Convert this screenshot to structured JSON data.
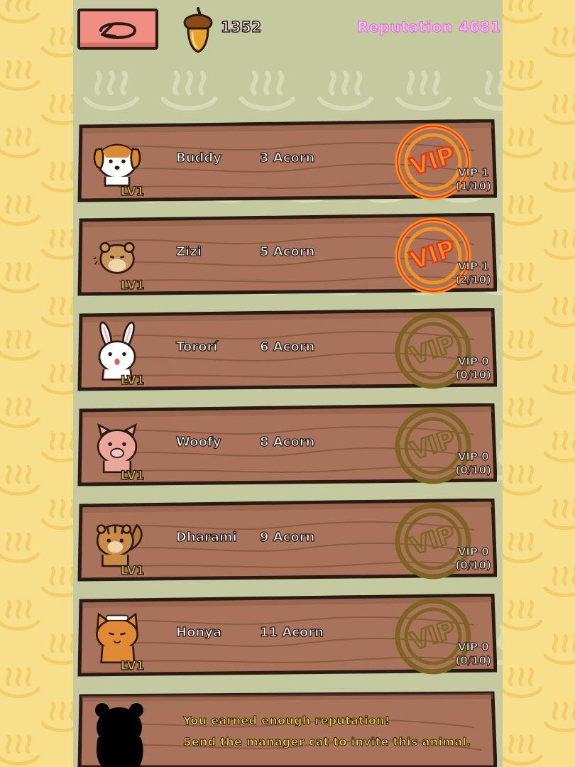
{
  "header": {
    "back_icon": "back-arrow-icon",
    "acorn_icon": "acorn-icon",
    "acorns": "1352",
    "reputation": "Reputation 4681"
  },
  "animals": [
    {
      "name": "Buddy",
      "cost": "3 Acorn",
      "level": "LV1",
      "vip_label": "VIP 1",
      "vip_progress": "(1/10)",
      "vip_active": true,
      "icon": "dog-icon"
    },
    {
      "name": "Zizi",
      "cost": "5 Acorn",
      "level": "LV1",
      "vip_label": "VIP 1",
      "vip_progress": "(2/10)",
      "vip_active": true,
      "icon": "hamster-icon"
    },
    {
      "name": "Tororí",
      "cost": "6 Acorn",
      "level": "LV1",
      "vip_label": "VIP 0",
      "vip_progress": "(0/10)",
      "vip_active": false,
      "icon": "rabbit-icon"
    },
    {
      "name": "Woofy",
      "cost": "8 Acorn",
      "level": "LV1",
      "vip_label": "VIP 0",
      "vip_progress": "(0/10)",
      "vip_active": false,
      "icon": "pig-icon"
    },
    {
      "name": "Dharami",
      "cost": "9 Acorn",
      "level": "LV1",
      "vip_label": "VIP 0",
      "vip_progress": "(0/10)",
      "vip_active": false,
      "icon": "chipmunk-icon"
    },
    {
      "name": "Honya",
      "cost": "11 Acorn",
      "level": "LV1",
      "vip_label": "VIP 0",
      "vip_progress": "(0/10)",
      "vip_active": false,
      "icon": "cat-icon"
    }
  ],
  "vip_badge_text": "VIP",
  "invite": {
    "line1": "You earned enough reputation!",
    "line2": "Send the manager cat to invite this animal.",
    "icon": "locked-animal-silhouette-icon"
  },
  "colors": {
    "background": "#f7dc86",
    "panel": "#c4c9a0",
    "wood": "#a8735a",
    "vip_active": "#f5931e",
    "vip_inactive": "#7d6420",
    "back_button": "#f08e84",
    "reputation": "#f7b8f5",
    "level_text": "#f6d93a"
  }
}
